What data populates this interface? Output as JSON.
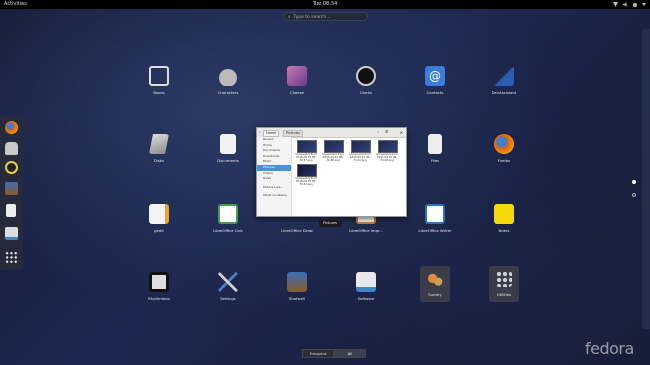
{
  "topbar": {
    "activities": "Activities",
    "clock": "Tue 08:34"
  },
  "search": {
    "placeholder": "Type to search..."
  },
  "apps": [
    {
      "label": "Boxes"
    },
    {
      "label": "Characters"
    },
    {
      "label": "Cheese"
    },
    {
      "label": "Clocks"
    },
    {
      "label": "Contacts"
    },
    {
      "label": "DevAssistant"
    },
    {
      "label": "Disks"
    },
    {
      "label": "Documents"
    },
    {
      "label": "Files"
    },
    {
      "label": "Firefox"
    },
    {
      "label": "gedit"
    },
    {
      "label": "LibreOffice Calc"
    },
    {
      "label": "LibreOffice Draw"
    },
    {
      "label": "LibreOffice Impr..."
    },
    {
      "label": "LibreOffice Writer"
    },
    {
      "label": "Notes"
    },
    {
      "label": "Rhythmbox"
    },
    {
      "label": "Settings"
    },
    {
      "label": "Shotwell"
    },
    {
      "label": "Software"
    },
    {
      "label": "Sundry"
    },
    {
      "label": "Utilities"
    }
  ],
  "window": {
    "crumbs": [
      "Home",
      "Pictures"
    ],
    "sidebar": [
      "Recent",
      "Home",
      "Documents",
      "Downloads",
      "Music",
      "Pictures",
      "Videos",
      "Trash",
      "Fedora Live...",
      "Other Locations"
    ],
    "files": [
      "Screenshot from 2015-09-15 08-32-57.png",
      "Screenshot from 2015-09-15 08-32-58.png",
      "Screenshot from 2015-09-15 08-33-02.png",
      "Screenshot from 2015-09-15 08-33-08.png",
      "Screenshot from 2015-09-15 08-33-44.png"
    ]
  },
  "tooltip": {
    "label": "Pictures"
  },
  "tabs": {
    "frequent": "Frequent",
    "all": "All"
  },
  "branding": {
    "text": "fedora"
  },
  "colors": {
    "selected": "#4a90d9",
    "firefox": "#e66000",
    "notes": "#f5d90a"
  }
}
